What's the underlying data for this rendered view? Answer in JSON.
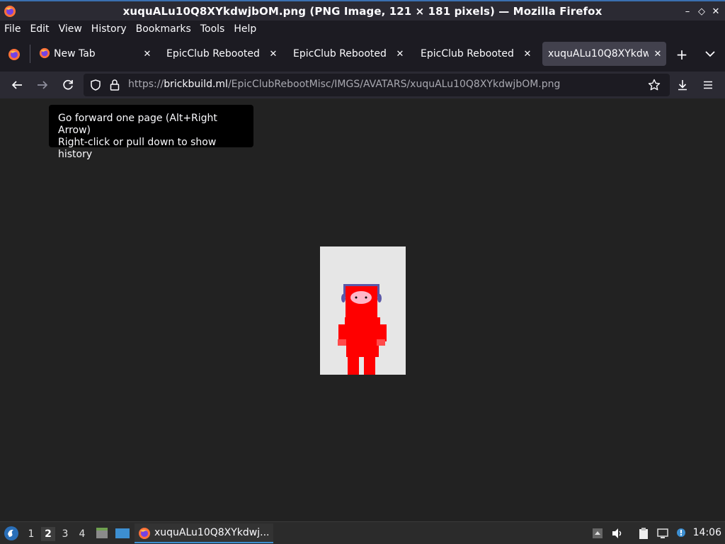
{
  "window": {
    "title": "xuquALu10Q8XYkdwjbOM.png (PNG Image, 121 × 181 pixels) — Mozilla Firefox"
  },
  "menubar": {
    "items": [
      "File",
      "Edit",
      "View",
      "History",
      "Bookmarks",
      "Tools",
      "Help"
    ]
  },
  "tabs": [
    {
      "label": "New Tab",
      "has_icon": true
    },
    {
      "label": "EpicClub Rebooted",
      "has_icon": false
    },
    {
      "label": "EpicClub Rebooted",
      "has_icon": false
    },
    {
      "label": "EpicClub Rebooted",
      "has_icon": false
    },
    {
      "label": "xuquALu10Q8XYkdwj",
      "has_icon": false,
      "active": true
    }
  ],
  "navbar": {
    "url_prefix": "https://",
    "url_domain": "brickbuild.ml",
    "url_path": "/EpicClubRebootMisc/IMGS/AVATARS/xuquALu10Q8XYkdwjbOM.png"
  },
  "tooltip": {
    "line1": "Go forward one page (Alt+Right Arrow)",
    "line2": "Right-click or pull down to show history"
  },
  "taskbar": {
    "workspaces": [
      "1",
      "2",
      "3",
      "4"
    ],
    "active_workspace": "2",
    "task_label": "xuquALu10Q8XYkdwj...",
    "clock": "14:06"
  },
  "colors": {
    "accent": "#3d8fd1",
    "avatar_red": "#ff0000",
    "avatar_headband": "#5b58a8",
    "avatar_face": "#ffb6c8"
  }
}
